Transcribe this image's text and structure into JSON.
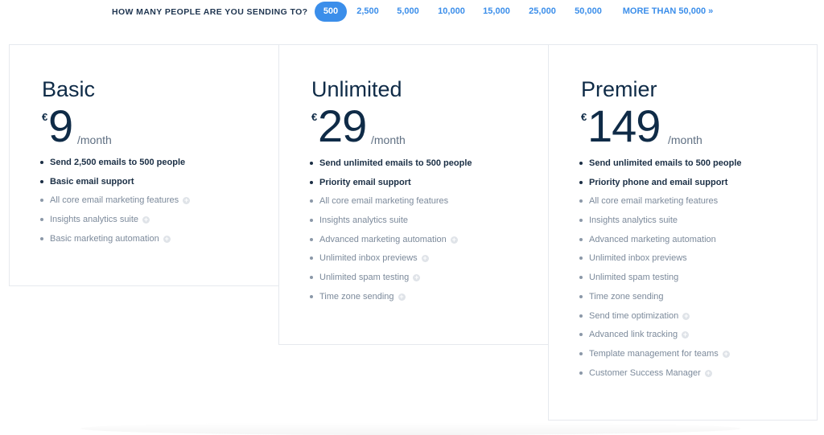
{
  "selector": {
    "question": "HOW MANY PEOPLE ARE YOU SENDING TO?",
    "options": [
      "500",
      "2,500",
      "5,000",
      "10,000",
      "15,000",
      "25,000",
      "50,000",
      "MORE THAN 50,000 »"
    ],
    "selected": "500",
    "accent_color": "#3b8eea"
  },
  "plans": [
    {
      "name": "Basic",
      "currency": "€",
      "price": "9",
      "period": "/month",
      "features": [
        {
          "text": "Send 2,500 emails to 500 people",
          "bold": true,
          "info": false
        },
        {
          "text": "Basic email support",
          "bold": true,
          "info": false
        },
        {
          "text": "All core email marketing features",
          "bold": false,
          "info": true
        },
        {
          "text": "Insights analytics suite",
          "bold": false,
          "info": true
        },
        {
          "text": "Basic marketing automation",
          "bold": false,
          "info": true
        }
      ]
    },
    {
      "name": "Unlimited",
      "currency": "€",
      "price": "29",
      "period": "/month",
      "features": [
        {
          "text": "Send unlimited emails to 500 people",
          "bold": true,
          "info": false
        },
        {
          "text": "Priority email support",
          "bold": true,
          "info": false
        },
        {
          "text": "All core email marketing features",
          "bold": false,
          "info": false
        },
        {
          "text": "Insights analytics suite",
          "bold": false,
          "info": false
        },
        {
          "text": "Advanced marketing automation",
          "bold": false,
          "info": true
        },
        {
          "text": "Unlimited inbox previews",
          "bold": false,
          "info": true
        },
        {
          "text": "Unlimited spam testing",
          "bold": false,
          "info": true
        },
        {
          "text": "Time zone sending",
          "bold": false,
          "info": true
        }
      ]
    },
    {
      "name": "Premier",
      "currency": "€",
      "price": "149",
      "period": "/month",
      "features": [
        {
          "text": "Send unlimited emails to 500 people",
          "bold": true,
          "info": false
        },
        {
          "text": "Priority phone and email support",
          "bold": true,
          "info": false
        },
        {
          "text": "All core email marketing features",
          "bold": false,
          "info": false
        },
        {
          "text": "Insights analytics suite",
          "bold": false,
          "info": false
        },
        {
          "text": "Advanced marketing automation",
          "bold": false,
          "info": false
        },
        {
          "text": "Unlimited inbox previews",
          "bold": false,
          "info": false
        },
        {
          "text": "Unlimited spam testing",
          "bold": false,
          "info": false
        },
        {
          "text": "Time zone sending",
          "bold": false,
          "info": false
        },
        {
          "text": "Send time optimization",
          "bold": false,
          "info": true
        },
        {
          "text": "Advanced link tracking",
          "bold": false,
          "info": true
        },
        {
          "text": "Template management for teams",
          "bold": false,
          "info": true
        },
        {
          "text": "Customer Success Manager",
          "bold": false,
          "info": true
        }
      ]
    }
  ]
}
